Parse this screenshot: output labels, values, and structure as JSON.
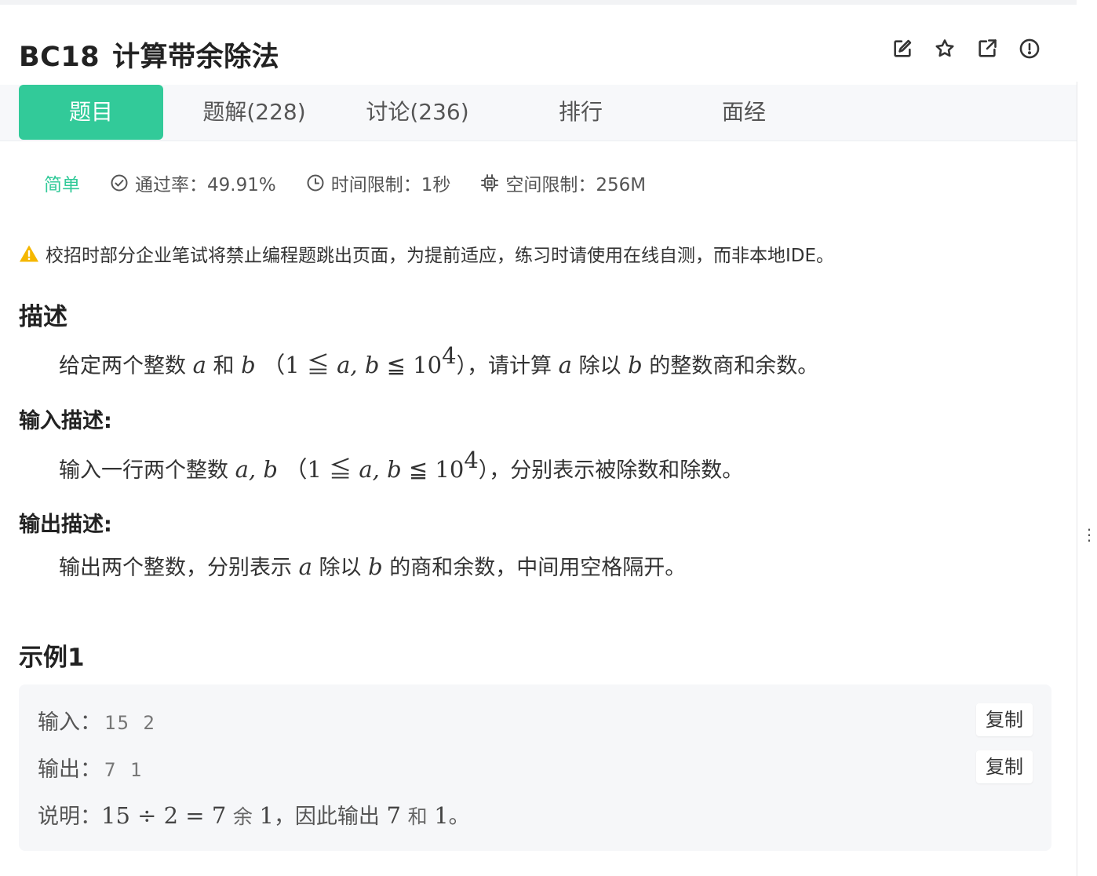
{
  "problem": {
    "code": "BC18",
    "title": "计算带余除法"
  },
  "icons": [
    "edit-icon",
    "star-icon",
    "share-icon",
    "report-icon"
  ],
  "tabs": [
    {
      "label": "题目",
      "active": true
    },
    {
      "label": "题解(228)",
      "active": false
    },
    {
      "label": "讨论(236)",
      "active": false
    },
    {
      "label": "排行",
      "active": false
    },
    {
      "label": "面经",
      "active": false
    }
  ],
  "meta": {
    "difficulty": "简单",
    "pass_rate": "通过率：49.91%",
    "time_limit": "时间限制：1秒",
    "space_limit": "空间限制：256M"
  },
  "warning": "校招时部分企业笔试将禁止编程题跳出页面，为提前适应，练习时请使用在线自测，而非本地IDE。",
  "sections": {
    "description_heading": "描述",
    "description": {
      "p1": "给定两个整数",
      "a": "a",
      "and": "和",
      "b": "b",
      "constraint_open": "（1 ≦ ",
      "ab": "a, b",
      "constraint_mid": " ≦ 10",
      "exp": "4",
      "constraint_close": "），请计算",
      "a2": "a",
      "div": "除以",
      "b2": "b",
      "tail": "的整数商和余数。"
    },
    "input_heading": "输入描述:",
    "input": {
      "p1": "输入一行两个整数",
      "ab": "a, b",
      "constraint_open": "（1 ≦ ",
      "ab2": "a, b",
      "constraint_mid": " ≦ 10",
      "exp": "4",
      "tail": "），分别表示被除数和除数。"
    },
    "output_heading": "输出描述:",
    "output": {
      "p1": "输出两个整数，分别表示",
      "a": "a",
      "div": "除以",
      "b": "b",
      "tail": "的商和余数，中间用空格隔开。"
    }
  },
  "example": {
    "heading": "示例1",
    "input_label": "输入：",
    "input_value": "15 2",
    "output_label": "输出：",
    "output_value": "7 1",
    "copy_label": "复制",
    "explain_label": "说明：",
    "explain_expr": "15 ÷ 2 = 7",
    "explain_rem_word": "余",
    "explain_rem": "1",
    "explain_mid": "，因此输出",
    "explain_q": "7",
    "explain_and": "和",
    "explain_r": "1",
    "explain_end": "。"
  },
  "colors": {
    "accent": "#32ca99",
    "warning": "#f5b700"
  }
}
